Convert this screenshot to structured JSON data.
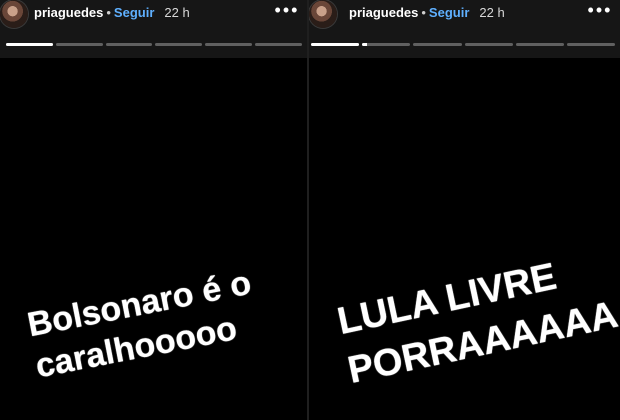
{
  "stories": [
    {
      "username": "priaguedes",
      "separator": "•",
      "follow_label": "Seguir",
      "timestamp": "22 h",
      "more_label": "•••",
      "progress": [
        1,
        0,
        0,
        0,
        0,
        0
      ],
      "caption_lines": [
        "Bolsonaro é o",
        "caralhooooo"
      ]
    },
    {
      "username": "priaguedes",
      "separator": "•",
      "follow_label": "Seguir",
      "timestamp": "22 h",
      "more_label": "•••",
      "progress": [
        1,
        0.1,
        0,
        0,
        0,
        0
      ],
      "caption_lines": [
        "LULA LIVRE",
        "PORRAAAAAA"
      ]
    }
  ],
  "colors": {
    "background": "#000000",
    "header": "#161616",
    "follow": "#5fb0ff",
    "text": "#ffffff"
  }
}
